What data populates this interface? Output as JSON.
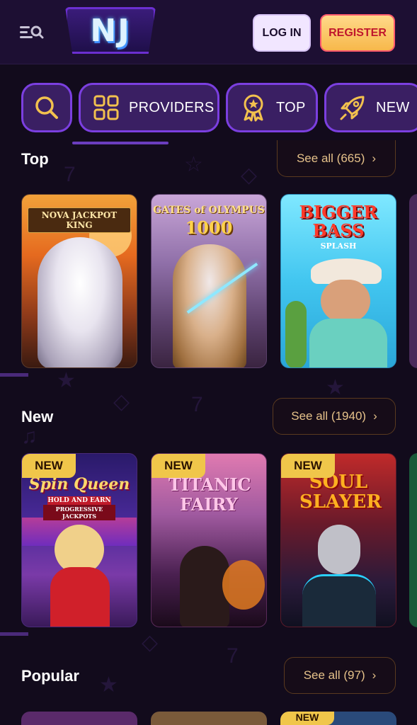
{
  "header": {
    "logo_text": "NJ",
    "login_label": "LOG IN",
    "register_label": "REGISTER"
  },
  "tabs": [
    {
      "label": "",
      "icon": "search-icon"
    },
    {
      "label": "PROVIDERS",
      "icon": "grid-icon"
    },
    {
      "label": "TOP",
      "icon": "award-icon"
    },
    {
      "label": "NEW",
      "icon": "rocket-icon"
    }
  ],
  "sections": {
    "top": {
      "title": "Top",
      "see_all": "See all (665)",
      "games": [
        {
          "title": "NOVA JACKPOT KING"
        },
        {
          "title": "GATES of OLYMPUS",
          "subtitle": "1000"
        },
        {
          "title": "BIGGER BASS",
          "subtitle": "SPLASH"
        }
      ]
    },
    "new": {
      "title": "New",
      "see_all": "See all (1940)",
      "badge": "NEW",
      "games": [
        {
          "title": "Spin Queen",
          "subtitle": "HOLD AND EARN",
          "tagline": "PROGRESSIVE JACKPOTS"
        },
        {
          "title": "TITANIC FAIRY"
        },
        {
          "title": "SOUL SLAYER"
        }
      ]
    },
    "popular": {
      "title": "Popular",
      "see_all": "See all (97)",
      "badge": "NEW"
    }
  },
  "colors": {
    "background": "#120b1c",
    "header": "#1d0f33",
    "tab_bg": "#3a1f63",
    "tab_border": "#7b3fe0",
    "accent_gold": "#e6c28a",
    "badge": "#f0c64a"
  }
}
